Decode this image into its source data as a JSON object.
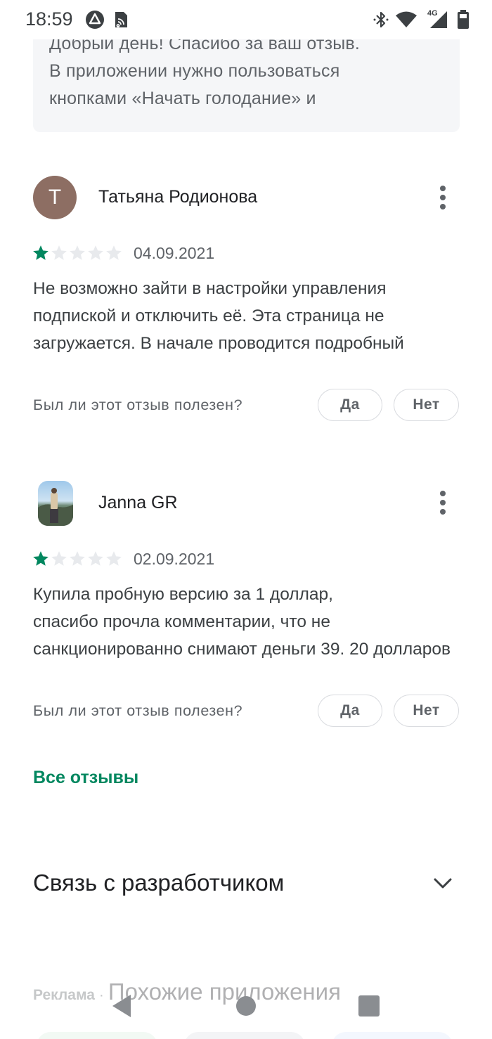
{
  "status_bar": {
    "time": "18:59",
    "left_icons": [
      "notification-icon",
      "cast-icon"
    ],
    "right_icons": [
      "bluetooth-icon",
      "wifi-icon",
      "signal-4g-icon",
      "battery-icon"
    ],
    "network_label": "4G"
  },
  "developer_reply": {
    "lines": [
      "Добрый день! Спасибо за ваш отзыв.",
      "В приложении нужно пользоваться",
      "кнопками «Начать голодание» и"
    ]
  },
  "reviews": [
    {
      "author": "Татьяна Родионова",
      "avatar_letter": "Т",
      "rating": 1,
      "max_rating": 5,
      "date": "04.09.2021",
      "text_lines": [
        "Не возможно зайти в настройки управления",
        "подпиской и отключить её. Эта страница не",
        "загружается. В начале проводится подробный"
      ],
      "helpful_question": "Был ли этот отзыв полезен?",
      "yes_label": "Да",
      "no_label": "Нет"
    },
    {
      "author": "Janna GR",
      "avatar_letter": "",
      "rating": 1,
      "max_rating": 5,
      "date": "02.09.2021",
      "text_lines": [
        "Купила пробную версию за 1 доллар,",
        "спасибо прочла комментарии, что не",
        "санкционированно снимают деньги 39. 20 долларов"
      ],
      "helpful_question": "Был ли этот отзыв полезен?",
      "yes_label": "Да",
      "no_label": "Нет"
    }
  ],
  "all_reviews_link": "Все отзывы",
  "developer_contact": {
    "title": "Связь с разработчиком"
  },
  "ads": {
    "label": "Реклама",
    "separator": "·",
    "title": "Похожие приложения"
  },
  "colors": {
    "accent_green": "#01875f",
    "star_filled": "#01875f",
    "star_empty": "#e8eaed",
    "avatar_bg": "#8d6e63"
  }
}
